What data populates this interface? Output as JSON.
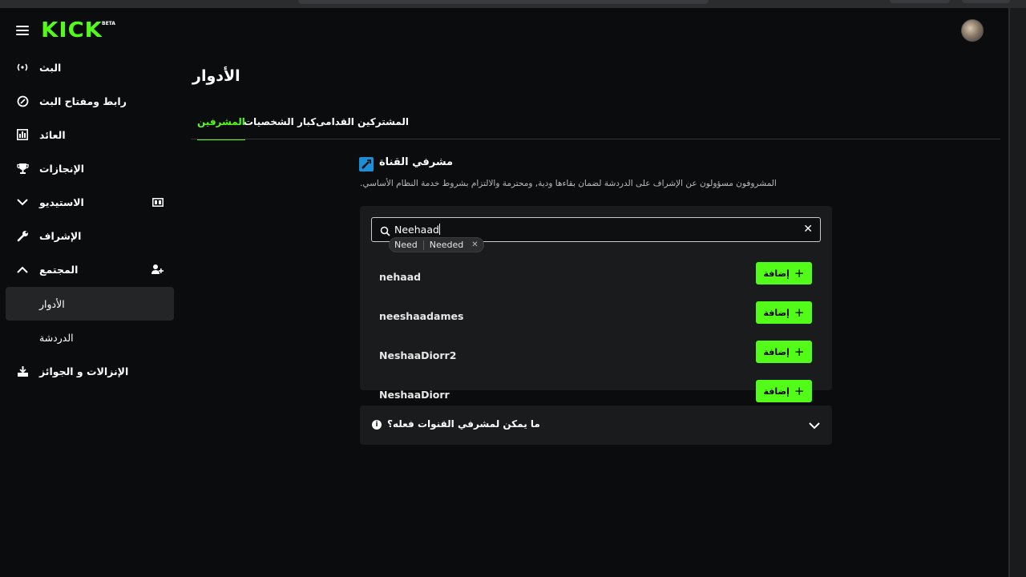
{
  "app": {
    "logo": "KICK",
    "logo_badge": "BETA",
    "accent": "#53fc18"
  },
  "sidebar": {
    "items": [
      {
        "label": "البث",
        "icon": "broadcast-icon"
      },
      {
        "label": "رابط ومفتاح البث",
        "icon": "link-icon"
      },
      {
        "label": "العائد",
        "icon": "revenue-icon"
      },
      {
        "label": "الإنجازات",
        "icon": "trophy-icon"
      },
      {
        "label": "الاستيديو",
        "icon": "chevron-down-icon"
      },
      {
        "label": "الإشراف",
        "icon": "wrench-icon"
      },
      {
        "label": "المجتمع",
        "icon": "chevron-up-icon"
      },
      {
        "label": "الأدوار"
      },
      {
        "label": "الدردشة"
      },
      {
        "label": "الإنزالات و الجوائز",
        "icon": "drops-icon"
      }
    ]
  },
  "main": {
    "title": "الأدوار",
    "tabs": [
      {
        "label": "المشرفين"
      },
      {
        "label": "كبار الشخصيات"
      },
      {
        "label": "المشتركين القدامى"
      }
    ],
    "section": {
      "title": "مشرفي القناة",
      "description": ".المشروفون مسؤولون عن الإشراف على الدردشة لضمان بقاءها ودية, ومحترمة والالتزام بشروط خدمة النظام الأساسي"
    },
    "search": {
      "value": "Neehaad"
    },
    "suggestions": [
      "Need",
      "Needed"
    ],
    "results": [
      {
        "username": "nehaad"
      },
      {
        "username": "neeshaadames"
      },
      {
        "username": "NeshaaDiorr2"
      },
      {
        "username": "NeshaaDiorr"
      }
    ],
    "add_label": "إضافة",
    "faq_question": "ما يمكن لمشرفي القنوات فعله؟"
  }
}
